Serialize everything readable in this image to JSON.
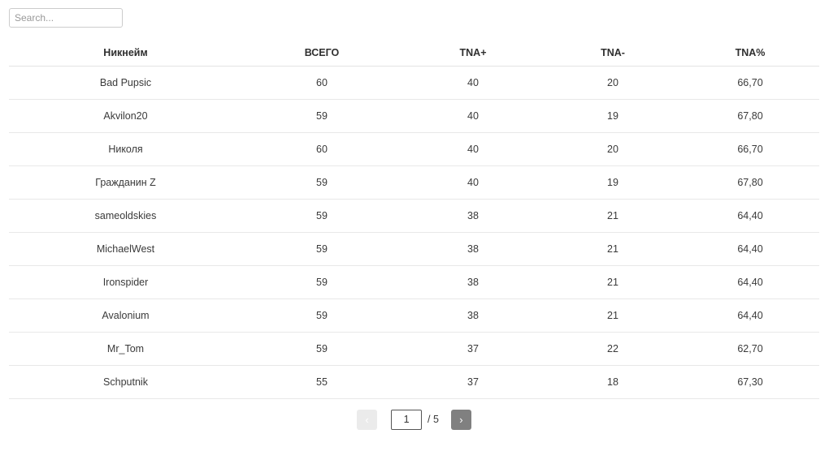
{
  "search": {
    "placeholder": "Search...",
    "value": ""
  },
  "table": {
    "columns": [
      {
        "key": "nickname",
        "label": "Никнейм"
      },
      {
        "key": "total",
        "label": "ВСЕГО"
      },
      {
        "key": "tna_plus",
        "label": "TNA+"
      },
      {
        "key": "tna_minus",
        "label": "TNA-"
      },
      {
        "key": "tna_pct",
        "label": "TNA%"
      }
    ],
    "rows": [
      {
        "nickname": "Bad Pupsic",
        "total": "60",
        "tna_plus": "40",
        "tna_minus": "20",
        "tna_pct": "66,70"
      },
      {
        "nickname": "Akvilon20",
        "total": "59",
        "tna_plus": "40",
        "tna_minus": "19",
        "tna_pct": "67,80"
      },
      {
        "nickname": "Николя",
        "total": "60",
        "tna_plus": "40",
        "tna_minus": "20",
        "tna_pct": "66,70"
      },
      {
        "nickname": "Гражданин Z",
        "total": "59",
        "tna_plus": "40",
        "tna_minus": "19",
        "tna_pct": "67,80"
      },
      {
        "nickname": "sameoldskies",
        "total": "59",
        "tna_plus": "38",
        "tna_minus": "21",
        "tna_pct": "64,40"
      },
      {
        "nickname": "MichaelWest",
        "total": "59",
        "tna_plus": "38",
        "tna_minus": "21",
        "tna_pct": "64,40"
      },
      {
        "nickname": "Ironspider",
        "total": "59",
        "tna_plus": "38",
        "tna_minus": "21",
        "tna_pct": "64,40"
      },
      {
        "nickname": "Avalonium",
        "total": "59",
        "tna_plus": "38",
        "tna_minus": "21",
        "tna_pct": "64,40"
      },
      {
        "nickname": "Mr_Tom",
        "total": "59",
        "tna_plus": "37",
        "tna_minus": "22",
        "tna_pct": "62,70"
      },
      {
        "nickname": "Schputnik",
        "total": "55",
        "tna_plus": "37",
        "tna_minus": "18",
        "tna_pct": "67,30"
      }
    ]
  },
  "pagination": {
    "prev_label": "‹",
    "next_label": "›",
    "current_page": "1",
    "total_pages_label": "/ 5",
    "total_pages": 5,
    "prev_disabled": true,
    "next_disabled": false
  },
  "colors": {
    "text": "#333333",
    "header_text": "#2f2f2f",
    "row_border": "#e8e8e8",
    "input_border": "#cccccc",
    "placeholder": "#999999",
    "prev_button_bg": "#ebebeb",
    "next_button_bg": "#808080"
  }
}
